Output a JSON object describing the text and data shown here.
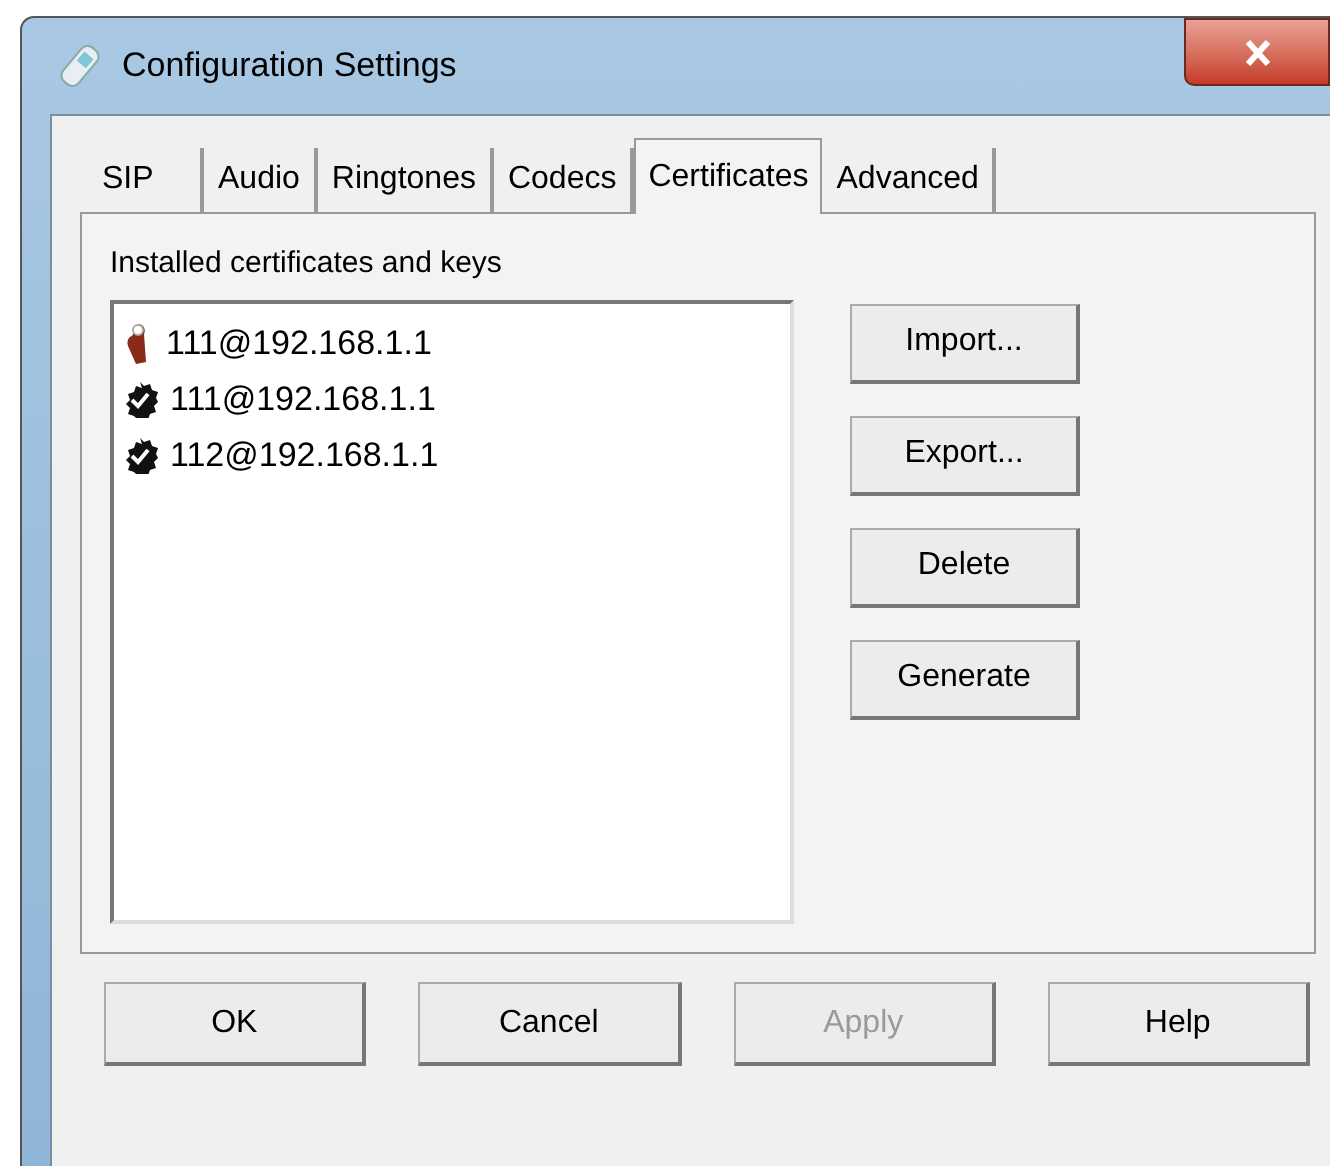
{
  "window": {
    "title": "Configuration Settings"
  },
  "tabs": [
    {
      "label": "SIP",
      "selected": false
    },
    {
      "label": "Audio",
      "selected": false
    },
    {
      "label": "Ringtones",
      "selected": false
    },
    {
      "label": "Codecs",
      "selected": false
    },
    {
      "label": "Certificates",
      "selected": true
    },
    {
      "label": "Advanced",
      "selected": false
    }
  ],
  "certificates": {
    "label": "Installed certificates and keys",
    "items": [
      {
        "kind": "key",
        "text": "111@192.168.1.1"
      },
      {
        "kind": "certificate",
        "text": "111@192.168.1.1"
      },
      {
        "kind": "certificate",
        "text": "112@192.168.1.1"
      }
    ],
    "buttons": [
      {
        "label": "Import...",
        "disabled": false
      },
      {
        "label": "Export...",
        "disabled": false
      },
      {
        "label": "Delete",
        "disabled": false
      },
      {
        "label": "Generate",
        "disabled": false
      }
    ]
  },
  "buttons": [
    {
      "label": "OK",
      "disabled": false
    },
    {
      "label": "Cancel",
      "disabled": false
    },
    {
      "label": "Apply",
      "disabled": true
    },
    {
      "label": "Help",
      "disabled": false
    }
  ]
}
